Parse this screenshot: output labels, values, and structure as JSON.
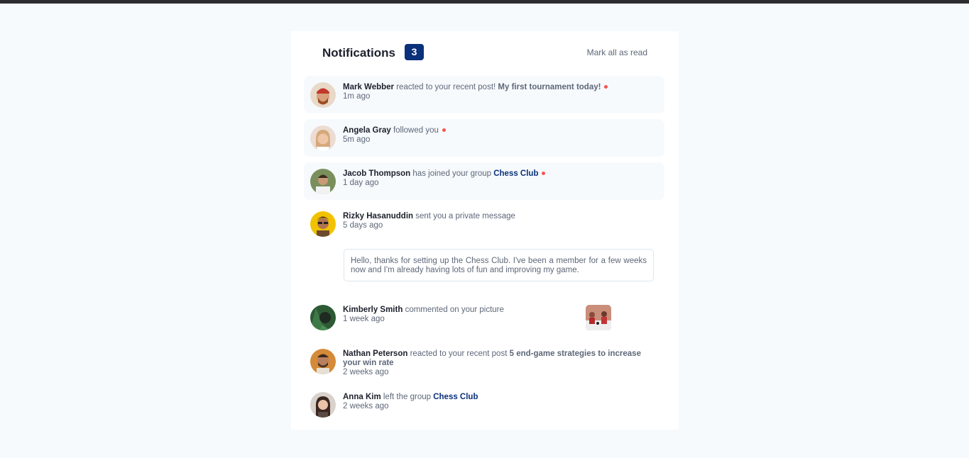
{
  "header": {
    "title": "Notifications",
    "unread_count": "3",
    "mark_all_label": "Mark all as read"
  },
  "notifications": [
    {
      "name": "Mark Webber",
      "action": "reacted to your recent post!",
      "target": "My first tournament today!",
      "target_type": "post",
      "time": "1m ago",
      "unread": true
    },
    {
      "name": "Angela Gray",
      "action": "followed you",
      "target": "",
      "time": "5m ago",
      "unread": true
    },
    {
      "name": "Jacob Thompson",
      "action": "has joined your group",
      "target": "Chess Club",
      "target_type": "group",
      "time": "1 day ago",
      "unread": true
    },
    {
      "name": "Rizky Hasanuddin",
      "action": "sent you a private message",
      "target": "",
      "time": "5 days ago",
      "unread": false,
      "message": "Hello, thanks for setting up the Chess Club. I've been a member for a few weeks now and I'm already having lots of fun and improving my game."
    },
    {
      "name": "Kimberly Smith",
      "action": "commented on your picture",
      "target": "",
      "time": "1 week ago",
      "unread": false
    },
    {
      "name": "Nathan Peterson",
      "action": "reacted to your recent post",
      "target": "5 end-game strategies to increase your win rate",
      "target_type": "post",
      "time": "2 weeks ago",
      "unread": false
    },
    {
      "name": "Anna Kim",
      "action": "left the group",
      "target": "Chess Club",
      "target_type": "group",
      "time": "2 weeks ago",
      "unread": false
    }
  ],
  "colors": {
    "background": "#f7fafd",
    "badge": "#0a317b",
    "unread_dot": "#f65552",
    "text_dark": "#1c202b",
    "text_muted": "#5e6778",
    "group_link": "#0a317b"
  }
}
